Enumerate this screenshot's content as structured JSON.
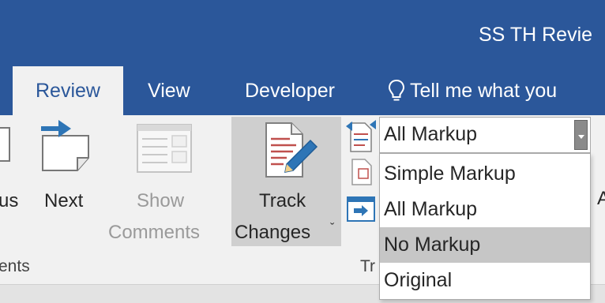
{
  "title_bar": {
    "document_title": "SS TH Revie"
  },
  "tabs": [
    {
      "label": "Review",
      "active": true
    },
    {
      "label": "View",
      "active": false
    },
    {
      "label": "Developer",
      "active": false
    }
  ],
  "tell_me": {
    "icon": "lightbulb-icon",
    "text": "Tell me what you"
  },
  "ribbon": {
    "previous_label": "us",
    "next_label": "Next",
    "show_comments_line1": "Show",
    "show_comments_line2": "Comments",
    "track_changes_line1": "Track",
    "track_changes_line2": "Changes",
    "track_changes_arrow": "ˇ",
    "comments_group_label": "ents",
    "tracking_group_label": "Tr",
    "right_partial": "A"
  },
  "markup_combo": {
    "selected": "All Markup",
    "options": [
      "Simple Markup",
      "All Markup",
      "No Markup",
      "Original"
    ],
    "hovered": "No Markup"
  },
  "colors": {
    "accent": "#2b579a",
    "ribbon": "#f1f1f1",
    "pressed": "#cfcfcf",
    "hover": "#c6c6c6"
  }
}
